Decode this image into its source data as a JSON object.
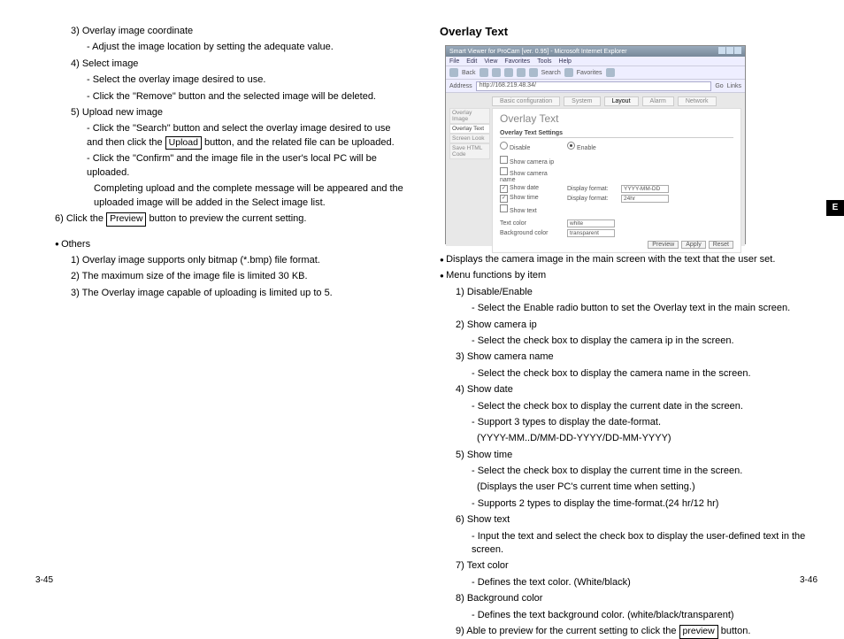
{
  "left": {
    "l1": "3) Overlay image coordinate",
    "l2": "- Adjust the image location by setting the adequate value.",
    "l3": "4) Select image",
    "l4": "- Select the overlay image desired to use.",
    "l5": "- Click the \"Remove\" button and the selected image will be deleted.",
    "l6": "5) Upload new image",
    "l7a": "- Click the \"Search\" button and select the overlay image desired to use and then click the ",
    "l7btn": "Upload",
    "l7b": " button, and the related file can be uploaded.",
    "l8": "- Click the \"Confirm\" and the image file in the user's local PC will be uploaded.",
    "l9": "Completing upload and the complete message will be appeared and the uploaded image will be added in the Select image list.",
    "l10a": "6) Click the ",
    "l10btn": "Preview",
    "l10b": " button to preview the current setting.",
    "others": "Others",
    "o1": "1) Overlay image supports only bitmap (*.bmp) file format.",
    "o2": "2) The maximum size of the image file is limited 30 KB.",
    "o3": "3) The Overlay image capable of uploading is limited up to 5.",
    "pagenum": "3-45"
  },
  "right": {
    "heading": "Overlay Text",
    "screenshot": {
      "title": "Smart Viewer for ProCam [ver. 0.95] - Microsoft Internet Explorer",
      "menu": [
        "File",
        "Edit",
        "View",
        "Favorites",
        "Tools",
        "Help"
      ],
      "back": "Back",
      "search": "Search",
      "favorites": "Favorites",
      "addressLabel": "Address",
      "address": "http://168.219.48.34/",
      "go": "Go",
      "links": "Links",
      "tabs": [
        "Basic configuration",
        "System",
        "Layout",
        "Alarm",
        "Network"
      ],
      "activeTab": "Layout",
      "sidebar": [
        "Overlay Image",
        "Overlay Text",
        "Screen Look",
        "Save HTML Code"
      ],
      "activeSidebar": "Overlay Text",
      "panelTitle": "Overlay Text",
      "groupTitle": "Overlay Text Settings",
      "disable": "Disable",
      "enable": "Enable",
      "rows": {
        "showCameraIp": "Show camera ip",
        "showCameraName": "Show camera name",
        "showDate": "Show date",
        "showTime": "Show time",
        "showText": "Show text",
        "displayFormat": "Display format:",
        "dateFmt": "YYYY-MM-DD",
        "timeFmt": "24hr",
        "textColor": "Text color",
        "textColorVal": "white",
        "bgColor": "Background color",
        "bgColorVal": "transparent"
      },
      "btns": [
        "Preview",
        "Apply",
        "Reset"
      ]
    },
    "b1": "Displays the camera image in the main screen with the text that the user set.",
    "b2": "Menu functions by item",
    "i1": "1) Disable/Enable",
    "i1a": "- Select the Enable radio button to set the Overlay text in the main screen.",
    "i2": "2) Show camera ip",
    "i2a": "- Select the check box to display the camera ip in the screen.",
    "i3": "3) Show camera name",
    "i3a": "- Select the check box to display the camera name in the screen.",
    "i4": "4) Show date",
    "i4a": "- Select the check box to display the current date in the screen.",
    "i4b": "- Support 3 types to display the date-format.",
    "i4c": "(YYYY-MM..D/MM-DD-YYYY/DD-MM-YYYY)",
    "i5": "5) Show time",
    "i5a": "- Select the check box to display the current time in the screen.",
    "i5b": "(Displays the user PC's current time when setting.)",
    "i5c": "- Supports 2 types to display the time-format.(24 hr/12 hr)",
    "i6": "6) Show text",
    "i6a": "- Input the text and select the check box to display the user-defined text in the screen.",
    "i7": "7) Text color",
    "i7a": "- Defines the text color. (White/black)",
    "i8": "8) Background color",
    "i8a": "- Defines the text background color. (white/black/transparent)",
    "i9a": "9) Able to preview for the current setting to click the ",
    "i9btn": "preview",
    "i9b": " button.",
    "pagenum": "3-46",
    "sidetab": "E"
  }
}
